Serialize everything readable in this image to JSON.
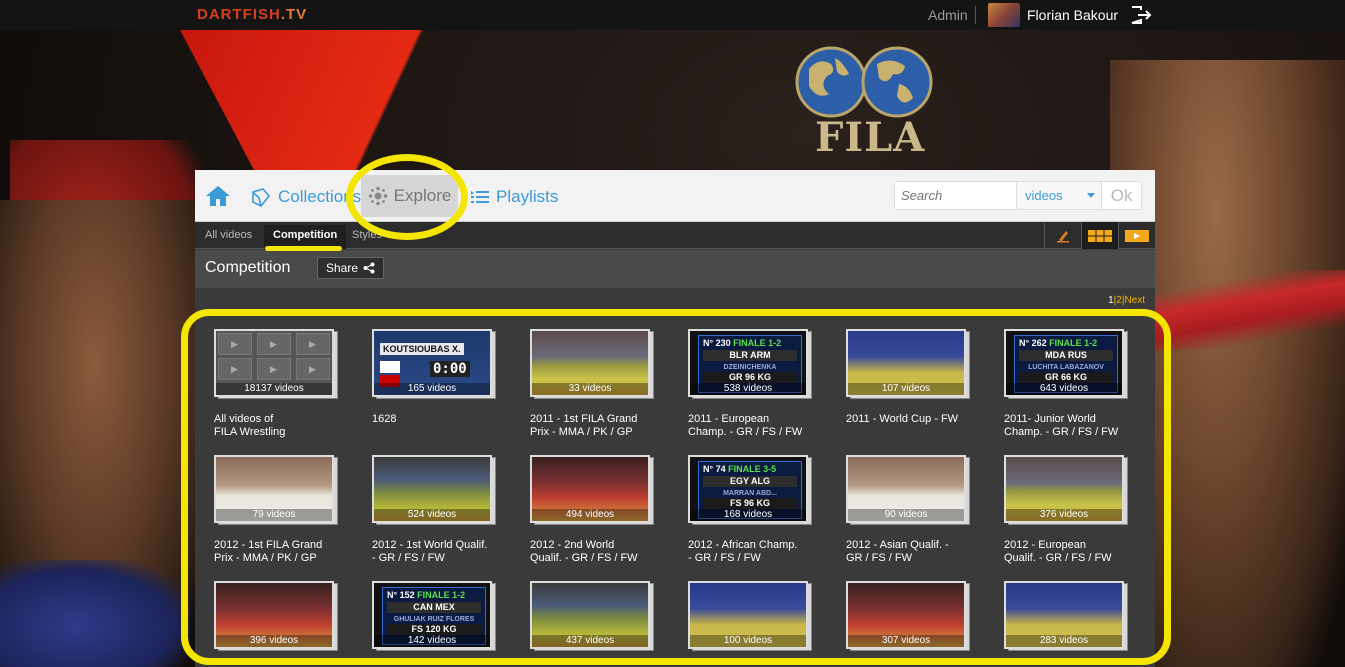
{
  "topbar": {
    "brand": "DARTFISH",
    "brand_suffix": ".TV",
    "admin_label": "Admin",
    "username": "Florian Bakour"
  },
  "logo": {
    "text": "FILA"
  },
  "nav": {
    "collections": "Collections",
    "explore": "Explore",
    "playlists": "Playlists",
    "search_placeholder": "Search",
    "search_scope": "videos",
    "ok_label": "Ok"
  },
  "subnav": {
    "tabs": [
      "All videos",
      "Competition",
      "Styles"
    ],
    "active": "Competition"
  },
  "titlebar": {
    "title": "Competition",
    "share_label": "Share"
  },
  "pager": {
    "page1": "1",
    "page2": "2",
    "next": "Next"
  },
  "colors": {
    "accent": "#3b9bd6",
    "highlight": "#f4e600",
    "brand": "#d8401c",
    "link": "#f4b400"
  },
  "tiles": [
    {
      "count": "18137 videos",
      "title1": "All videos of",
      "title2": "FILA Wrestling"
    },
    {
      "count": "165 videos",
      "title1": "1628",
      "title2": ""
    },
    {
      "count": "33 videos",
      "title1": "2011 - 1st FILA Grand",
      "title2": "Prix - MMA / PK / GP"
    },
    {
      "count": "538 videos",
      "title1": "2011 - European",
      "title2": "Champ. - GR / FS / FW"
    },
    {
      "count": "107 videos",
      "title1": "2011 - World Cup - FW",
      "title2": ""
    },
    {
      "count": "643 videos",
      "title1": "2011- Junior World",
      "title2": "Champ. - GR / FS / FW"
    },
    {
      "count": "79 videos",
      "title1": "2012 - 1st FILA Grand",
      "title2": "Prix - MMA / PK / GP"
    },
    {
      "count": "524 videos",
      "title1": "2012 - 1st World Qualif.",
      "title2": "- GR / FS / FW"
    },
    {
      "count": "494 videos",
      "title1": "2012 - 2nd World",
      "title2": "Qualif. - GR / FS / FW"
    },
    {
      "count": "168 videos",
      "title1": "2012 - African Champ.",
      "title2": "- GR / FS / FW"
    },
    {
      "count": "90 videos",
      "title1": "2012 - Asian Qualif. -",
      "title2": "GR / FS / FW"
    },
    {
      "count": "376 videos",
      "title1": "2012 - European",
      "title2": "Qualif. - GR / FS / FW"
    },
    {
      "count": "396 videos",
      "title1": "",
      "title2": ""
    },
    {
      "count": "142 videos",
      "title1": "",
      "title2": ""
    },
    {
      "count": "437 videos",
      "title1": "",
      "title2": ""
    },
    {
      "count": "100 videos",
      "title1": "",
      "title2": ""
    },
    {
      "count": "307 videos",
      "title1": "",
      "title2": ""
    },
    {
      "count": "283 videos",
      "title1": "",
      "title2": ""
    }
  ],
  "scoreboards": {
    "t3": {
      "no": "N° 230",
      "round": "FINALE 1-2",
      "teams": "BLR ARM",
      "names": "DZEINICHENKA ALEKSANYAN",
      "cat": "GR 96 KG"
    },
    "t5": {
      "no": "N° 262",
      "round": "FINALE 1-2",
      "teams": "MDA RUS",
      "names": "LUCHITA LABAZANOV",
      "cat": "GR 66 KG"
    },
    "t9": {
      "no": "N° 74",
      "round": "FINALE 3-5",
      "teams": "EGY ALG",
      "names": "MARRAN ABD...",
      "cat": "FS 96 KG"
    },
    "t13": {
      "no": "N° 152",
      "round": "FINALE 1-2",
      "teams": "CAN MEX",
      "names": "GHULIAK RUIZ FLORES",
      "cat": "FS 120 KG"
    }
  },
  "koutsi": {
    "name": "KOUTSIOUBAS X.",
    "time": "0:00"
  }
}
